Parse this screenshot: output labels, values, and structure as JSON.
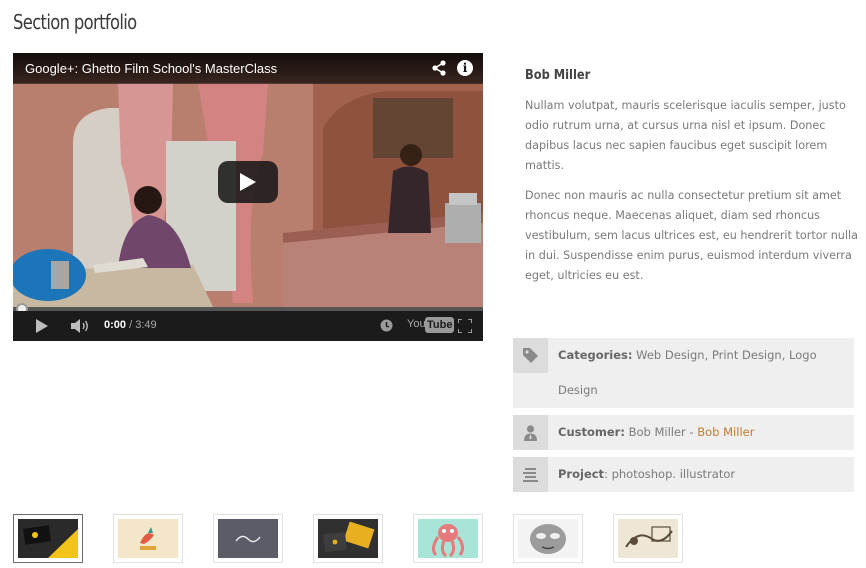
{
  "page": {
    "title": "Section portfolio"
  },
  "video": {
    "title": "Google+: Ghetto Film School's MasterClass",
    "time_current": "0:00",
    "time_separator": "/",
    "time_total": "3:49",
    "progress_percent": 0,
    "logo_you": "You",
    "logo_tube": "Tube",
    "info_glyph": "i"
  },
  "author": {
    "name": "Bob Miller",
    "paragraphs": [
      "Nullam volutpat, mauris scelerisque iaculis semper, justo odio rutrum urna, at cursus urna nisl et ipsum. Donec dapibus lacus nec sapien faucibus eget suscipit lorem mattis.",
      "Donec non mauris ac nulla consectetur pretium sit amet rhoncus neque. Maecenas aliquet, diam sed rhoncus vestibulum, sem lacus ultrices est, eu hendrerit tortor nulla in dui. Suspendisse enim purus, euismod interdum viverra eget, ultricies eu est."
    ]
  },
  "meta": {
    "categories": {
      "label": "Categories:",
      "value": "Web Design, Print Design, Logo Design",
      "icon": "tag-icon"
    },
    "customer": {
      "label": "Customer:",
      "value": "Bob Miller -",
      "link": "Bob Miller",
      "icon": "user-icon"
    },
    "project": {
      "label": "Project",
      "separator": ":",
      "value": "photoshop. illustrator",
      "icon": "list-icon"
    }
  },
  "thumbnails": [
    {
      "name": "business-cards-yellow",
      "active": true
    },
    {
      "name": "bird-logo",
      "active": false
    },
    {
      "name": "script-logo-dark",
      "active": false
    },
    {
      "name": "envelope-card",
      "active": false
    },
    {
      "name": "octopus-illustration",
      "active": false
    },
    {
      "name": "mask-sketch",
      "active": false
    },
    {
      "name": "ink-drawing",
      "active": false
    }
  ],
  "colors": {
    "accent_link": "#c27b2d",
    "meta_bg": "#efefef",
    "player_bg": "#1b1b1b"
  }
}
